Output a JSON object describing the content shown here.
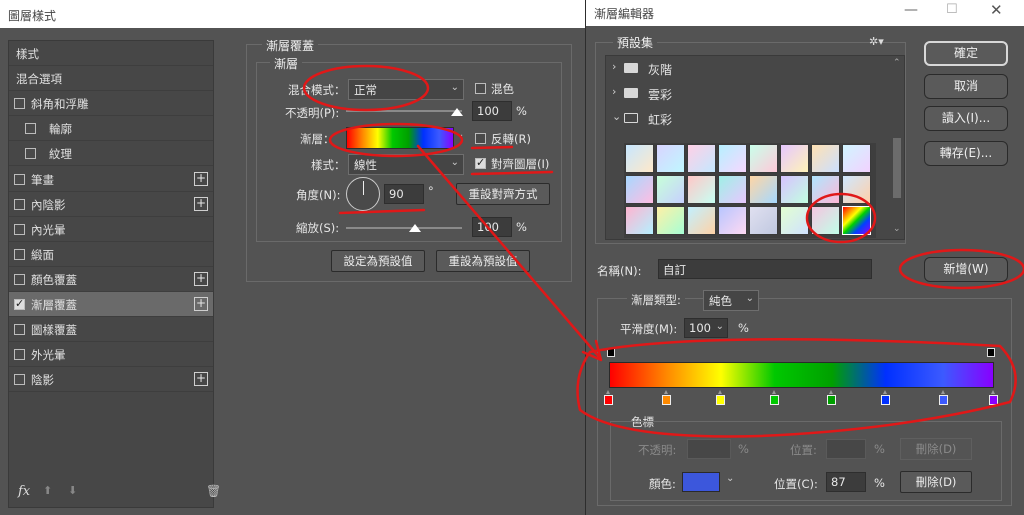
{
  "layer_style": {
    "title": "圖層樣式",
    "sidebar": [
      {
        "label": "樣式",
        "checkbox": false
      },
      {
        "label": "混合選項",
        "checkbox": false
      },
      {
        "label": "斜角和浮雕",
        "checkbox": true,
        "checked": false
      },
      {
        "label": "輪廓",
        "checkbox": true,
        "checked": false,
        "indent": true
      },
      {
        "label": "紋理",
        "checkbox": true,
        "checked": false,
        "indent": true
      },
      {
        "label": "筆畫",
        "checkbox": true,
        "checked": false,
        "plus": true
      },
      {
        "label": "內陰影",
        "checkbox": true,
        "checked": false,
        "plus": true
      },
      {
        "label": "內光暈",
        "checkbox": true,
        "checked": false
      },
      {
        "label": "緞面",
        "checkbox": true,
        "checked": false
      },
      {
        "label": "顏色覆蓋",
        "checkbox": true,
        "checked": false,
        "plus": true
      },
      {
        "label": "漸層覆蓋",
        "checkbox": true,
        "checked": true,
        "plus": true,
        "active": true
      },
      {
        "label": "圖樣覆蓋",
        "checkbox": true,
        "checked": false
      },
      {
        "label": "外光暈",
        "checkbox": true,
        "checked": false
      },
      {
        "label": "陰影",
        "checkbox": true,
        "checked": false,
        "plus": true
      }
    ],
    "footer": {
      "fx": "fx",
      "up": "⬆",
      "down": "⬇",
      "trash": "🗑"
    },
    "panel": {
      "section_title": "漸層覆蓋",
      "sub_title": "漸層",
      "blend_mode_label": "混合模式：",
      "blend_mode_value": "正常",
      "dither_label": "混色",
      "opacity_label": "不透明(P):",
      "opacity_value": "100",
      "opacity_unit": "%",
      "opacity_level": 1.0,
      "gradient_label": "漸層：",
      "reverse_label": "反轉(R)",
      "style_label": "樣式：",
      "style_value": "線性",
      "align_label": "對齊圖層(I)",
      "align_checked": true,
      "angle_label": "角度(N):",
      "angle_value": "90",
      "angle_unit": "°",
      "reset_align_label": "重設對齊方式",
      "scale_label": "縮放(S):",
      "scale_value": "100",
      "scale_unit": "%",
      "scale_level": 0.5,
      "make_default_label": "設定為預設值",
      "reset_default_label": "重設為預設值"
    }
  },
  "gradient_editor": {
    "title": "漸層編輯器",
    "presets_label": "預設集",
    "gear_icon": "gear-icon",
    "folders": [
      {
        "label": "灰階",
        "expanded": false
      },
      {
        "label": "雲彩",
        "expanded": false
      },
      {
        "label": "虹彩",
        "expanded": true
      }
    ],
    "buttons": {
      "ok": "確定",
      "cancel": "取消",
      "import": "讀入(I)...",
      "export": "轉存(E)...",
      "new": "新增(W)"
    },
    "name_label": "名稱(N):",
    "name_value": "自訂",
    "type_label": "漸層類型:",
    "type_value": "純色",
    "smooth_label": "平滑度(M):",
    "smooth_value": "100",
    "smooth_unit": "%",
    "color_stops": [
      {
        "color": "#ff0000",
        "position": 0
      },
      {
        "color": "#ff8a00",
        "position": 15
      },
      {
        "color": "#ffff00",
        "position": 29
      },
      {
        "color": "#00c800",
        "position": 43
      },
      {
        "color": "#00a000",
        "position": 58
      },
      {
        "color": "#0030ff",
        "position": 72
      },
      {
        "color": "#3c5aff",
        "position": 87
      },
      {
        "color": "#8800ff",
        "position": 100
      }
    ],
    "stops_section_label": "色標",
    "opacity_label": "不透明:",
    "opacity_unit": "%",
    "opacity_position_label": "位置:",
    "opacity_position_unit": "%",
    "opacity_delete_label": "刪除(D)",
    "color_label": "顏色:",
    "color_value": "#3c57dc",
    "color_position_label": "位置(C):",
    "color_position_value": "87",
    "color_position_unit": "%",
    "color_delete_label": "刪除(D)"
  },
  "annotations": {
    "color": "#e01818"
  }
}
